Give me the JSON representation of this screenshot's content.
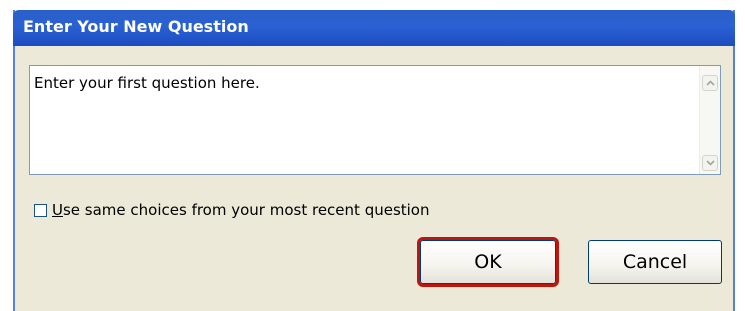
{
  "dialog": {
    "title": "Enter Your New Question",
    "question_text": "Enter your first question here.",
    "checkbox": {
      "checked": false,
      "label_mnemonic": "U",
      "label_rest": "se same choices from your most recent question"
    },
    "buttons": {
      "ok_label": "OK",
      "cancel_label": "Cancel"
    }
  },
  "colors": {
    "titlebar": "#2a61d4",
    "dialog_bg": "#ece9d8",
    "ok_highlight": "#c0150a"
  },
  "icons": {
    "scroll_up": "scroll-up-arrow-icon",
    "scroll_down": "scroll-down-arrow-icon"
  }
}
